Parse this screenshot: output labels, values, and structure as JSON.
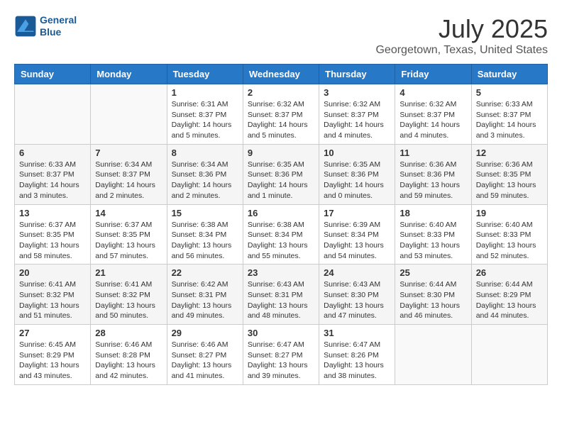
{
  "header": {
    "logo_line1": "General",
    "logo_line2": "Blue",
    "month_year": "July 2025",
    "location": "Georgetown, Texas, United States"
  },
  "weekdays": [
    "Sunday",
    "Monday",
    "Tuesday",
    "Wednesday",
    "Thursday",
    "Friday",
    "Saturday"
  ],
  "weeks": [
    [
      {
        "day": "",
        "info": ""
      },
      {
        "day": "",
        "info": ""
      },
      {
        "day": "1",
        "info": "Sunrise: 6:31 AM\nSunset: 8:37 PM\nDaylight: 14 hours and 5 minutes."
      },
      {
        "day": "2",
        "info": "Sunrise: 6:32 AM\nSunset: 8:37 PM\nDaylight: 14 hours and 5 minutes."
      },
      {
        "day": "3",
        "info": "Sunrise: 6:32 AM\nSunset: 8:37 PM\nDaylight: 14 hours and 4 minutes."
      },
      {
        "day": "4",
        "info": "Sunrise: 6:32 AM\nSunset: 8:37 PM\nDaylight: 14 hours and 4 minutes."
      },
      {
        "day": "5",
        "info": "Sunrise: 6:33 AM\nSunset: 8:37 PM\nDaylight: 14 hours and 3 minutes."
      }
    ],
    [
      {
        "day": "6",
        "info": "Sunrise: 6:33 AM\nSunset: 8:37 PM\nDaylight: 14 hours and 3 minutes."
      },
      {
        "day": "7",
        "info": "Sunrise: 6:34 AM\nSunset: 8:37 PM\nDaylight: 14 hours and 2 minutes."
      },
      {
        "day": "8",
        "info": "Sunrise: 6:34 AM\nSunset: 8:36 PM\nDaylight: 14 hours and 2 minutes."
      },
      {
        "day": "9",
        "info": "Sunrise: 6:35 AM\nSunset: 8:36 PM\nDaylight: 14 hours and 1 minute."
      },
      {
        "day": "10",
        "info": "Sunrise: 6:35 AM\nSunset: 8:36 PM\nDaylight: 14 hours and 0 minutes."
      },
      {
        "day": "11",
        "info": "Sunrise: 6:36 AM\nSunset: 8:36 PM\nDaylight: 13 hours and 59 minutes."
      },
      {
        "day": "12",
        "info": "Sunrise: 6:36 AM\nSunset: 8:35 PM\nDaylight: 13 hours and 59 minutes."
      }
    ],
    [
      {
        "day": "13",
        "info": "Sunrise: 6:37 AM\nSunset: 8:35 PM\nDaylight: 13 hours and 58 minutes."
      },
      {
        "day": "14",
        "info": "Sunrise: 6:37 AM\nSunset: 8:35 PM\nDaylight: 13 hours and 57 minutes."
      },
      {
        "day": "15",
        "info": "Sunrise: 6:38 AM\nSunset: 8:34 PM\nDaylight: 13 hours and 56 minutes."
      },
      {
        "day": "16",
        "info": "Sunrise: 6:38 AM\nSunset: 8:34 PM\nDaylight: 13 hours and 55 minutes."
      },
      {
        "day": "17",
        "info": "Sunrise: 6:39 AM\nSunset: 8:34 PM\nDaylight: 13 hours and 54 minutes."
      },
      {
        "day": "18",
        "info": "Sunrise: 6:40 AM\nSunset: 8:33 PM\nDaylight: 13 hours and 53 minutes."
      },
      {
        "day": "19",
        "info": "Sunrise: 6:40 AM\nSunset: 8:33 PM\nDaylight: 13 hours and 52 minutes."
      }
    ],
    [
      {
        "day": "20",
        "info": "Sunrise: 6:41 AM\nSunset: 8:32 PM\nDaylight: 13 hours and 51 minutes."
      },
      {
        "day": "21",
        "info": "Sunrise: 6:41 AM\nSunset: 8:32 PM\nDaylight: 13 hours and 50 minutes."
      },
      {
        "day": "22",
        "info": "Sunrise: 6:42 AM\nSunset: 8:31 PM\nDaylight: 13 hours and 49 minutes."
      },
      {
        "day": "23",
        "info": "Sunrise: 6:43 AM\nSunset: 8:31 PM\nDaylight: 13 hours and 48 minutes."
      },
      {
        "day": "24",
        "info": "Sunrise: 6:43 AM\nSunset: 8:30 PM\nDaylight: 13 hours and 47 minutes."
      },
      {
        "day": "25",
        "info": "Sunrise: 6:44 AM\nSunset: 8:30 PM\nDaylight: 13 hours and 46 minutes."
      },
      {
        "day": "26",
        "info": "Sunrise: 6:44 AM\nSunset: 8:29 PM\nDaylight: 13 hours and 44 minutes."
      }
    ],
    [
      {
        "day": "27",
        "info": "Sunrise: 6:45 AM\nSunset: 8:29 PM\nDaylight: 13 hours and 43 minutes."
      },
      {
        "day": "28",
        "info": "Sunrise: 6:46 AM\nSunset: 8:28 PM\nDaylight: 13 hours and 42 minutes."
      },
      {
        "day": "29",
        "info": "Sunrise: 6:46 AM\nSunset: 8:27 PM\nDaylight: 13 hours and 41 minutes."
      },
      {
        "day": "30",
        "info": "Sunrise: 6:47 AM\nSunset: 8:27 PM\nDaylight: 13 hours and 39 minutes."
      },
      {
        "day": "31",
        "info": "Sunrise: 6:47 AM\nSunset: 8:26 PM\nDaylight: 13 hours and 38 minutes."
      },
      {
        "day": "",
        "info": ""
      },
      {
        "day": "",
        "info": ""
      }
    ]
  ]
}
